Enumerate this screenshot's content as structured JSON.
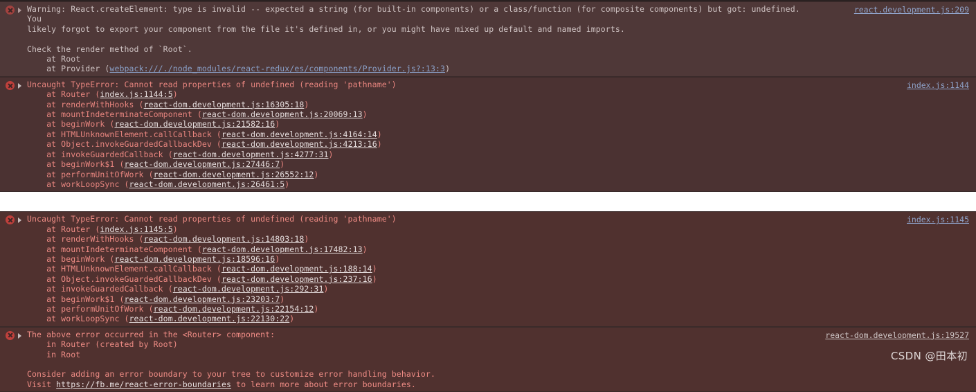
{
  "console": {
    "groups": [
      {
        "id": "group-1",
        "entries": [
          {
            "id": "entry-warning-createelement",
            "level": "warn",
            "icon": "error-circle-icon",
            "expander": "disclosure-triangle-icon",
            "origin": "react.development.js:209",
            "lines": [
              {
                "segments": [
                  {
                    "t": "Warning: React.createElement: type is invalid -- expected a string (for built-in components) or a class/function (for composite components) but got: undefined. You"
                  }
                ]
              },
              {
                "segments": [
                  {
                    "t": "likely forgot to export your component from the file it's defined in, or you might have mixed up default and named imports."
                  }
                ]
              },
              {
                "segments": [
                  {
                    "t": ""
                  }
                ]
              },
              {
                "segments": [
                  {
                    "t": "Check the render method of `Root`."
                  }
                ]
              },
              {
                "segments": [
                  {
                    "t": "    at Root"
                  }
                ]
              },
              {
                "segments": [
                  {
                    "t": "    at Provider ("
                  },
                  {
                    "t": "webpack:///./node_modules/react-redux/es/components/Provider.js?:13:3",
                    "link": true
                  },
                  {
                    "t": ")"
                  }
                ]
              }
            ]
          },
          {
            "id": "entry-uncaught-typeerror-1144",
            "level": "err",
            "icon": "error-circle-icon",
            "expander": "disclosure-triangle-icon",
            "origin": "index.js:1144",
            "lines": [
              {
                "segments": [
                  {
                    "t": "Uncaught TypeError: Cannot read properties of undefined (reading 'pathname')"
                  }
                ]
              },
              {
                "segments": [
                  {
                    "t": "    at Router ("
                  },
                  {
                    "t": "index.js:1144:5",
                    "link": true,
                    "white": true
                  },
                  {
                    "t": ")"
                  }
                ]
              },
              {
                "segments": [
                  {
                    "t": "    at renderWithHooks ("
                  },
                  {
                    "t": "react-dom.development.js:16305:18",
                    "link": true,
                    "white": true
                  },
                  {
                    "t": ")"
                  }
                ]
              },
              {
                "segments": [
                  {
                    "t": "    at mountIndeterminateComponent ("
                  },
                  {
                    "t": "react-dom.development.js:20069:13",
                    "link": true,
                    "white": true
                  },
                  {
                    "t": ")"
                  }
                ]
              },
              {
                "segments": [
                  {
                    "t": "    at beginWork ("
                  },
                  {
                    "t": "react-dom.development.js:21582:16",
                    "link": true,
                    "white": true
                  },
                  {
                    "t": ")"
                  }
                ]
              },
              {
                "segments": [
                  {
                    "t": "    at HTMLUnknownElement.callCallback ("
                  },
                  {
                    "t": "react-dom.development.js:4164:14",
                    "link": true,
                    "white": true
                  },
                  {
                    "t": ")"
                  }
                ]
              },
              {
                "segments": [
                  {
                    "t": "    at Object.invokeGuardedCallbackDev ("
                  },
                  {
                    "t": "react-dom.development.js:4213:16",
                    "link": true,
                    "white": true
                  },
                  {
                    "t": ")"
                  }
                ]
              },
              {
                "segments": [
                  {
                    "t": "    at invokeGuardedCallback ("
                  },
                  {
                    "t": "react-dom.development.js:4277:31",
                    "link": true,
                    "white": true
                  },
                  {
                    "t": ")"
                  }
                ]
              },
              {
                "segments": [
                  {
                    "t": "    at beginWork$1 ("
                  },
                  {
                    "t": "react-dom.development.js:27446:7",
                    "link": true,
                    "white": true
                  },
                  {
                    "t": ")"
                  }
                ]
              },
              {
                "segments": [
                  {
                    "t": "    at performUnitOfWork ("
                  },
                  {
                    "t": "react-dom.development.js:26552:12",
                    "link": true,
                    "white": true
                  },
                  {
                    "t": ")"
                  }
                ]
              },
              {
                "segments": [
                  {
                    "t": "    at workLoopSync ("
                  },
                  {
                    "t": "react-dom.development.js:26461:5",
                    "link": true,
                    "white": true
                  },
                  {
                    "t": ")"
                  }
                ]
              }
            ]
          }
        ]
      },
      {
        "id": "group-2",
        "entries": [
          {
            "id": "entry-uncaught-typeerror-1145",
            "level": "err-bright",
            "icon": "error-circle-icon",
            "expander": "disclosure-triangle-icon",
            "origin": "index.js:1145",
            "lines": [
              {
                "segments": [
                  {
                    "t": "Uncaught TypeError: Cannot read properties of undefined (reading 'pathname')"
                  }
                ]
              },
              {
                "segments": [
                  {
                    "t": "    at Router ("
                  },
                  {
                    "t": "index.js:1145:5",
                    "link": true,
                    "white": true
                  },
                  {
                    "t": ")"
                  }
                ]
              },
              {
                "segments": [
                  {
                    "t": "    at renderWithHooks ("
                  },
                  {
                    "t": "react-dom.development.js:14803:18",
                    "link": true,
                    "white": true
                  },
                  {
                    "t": ")"
                  }
                ]
              },
              {
                "segments": [
                  {
                    "t": "    at mountIndeterminateComponent ("
                  },
                  {
                    "t": "react-dom.development.js:17482:13",
                    "link": true,
                    "white": true
                  },
                  {
                    "t": ")"
                  }
                ]
              },
              {
                "segments": [
                  {
                    "t": "    at beginWork ("
                  },
                  {
                    "t": "react-dom.development.js:18596:16",
                    "link": true,
                    "white": true
                  },
                  {
                    "t": ")"
                  }
                ]
              },
              {
                "segments": [
                  {
                    "t": "    at HTMLUnknownElement.callCallback ("
                  },
                  {
                    "t": "react-dom.development.js:188:14",
                    "link": true,
                    "white": true
                  },
                  {
                    "t": ")"
                  }
                ]
              },
              {
                "segments": [
                  {
                    "t": "    at Object.invokeGuardedCallbackDev ("
                  },
                  {
                    "t": "react-dom.development.js:237:16",
                    "link": true,
                    "white": true
                  },
                  {
                    "t": ")"
                  }
                ]
              },
              {
                "segments": [
                  {
                    "t": "    at invokeGuardedCallback ("
                  },
                  {
                    "t": "react-dom.development.js:292:31",
                    "link": true,
                    "white": true
                  },
                  {
                    "t": ")"
                  }
                ]
              },
              {
                "segments": [
                  {
                    "t": "    at beginWork$1 ("
                  },
                  {
                    "t": "react-dom.development.js:23203:7",
                    "link": true,
                    "white": true
                  },
                  {
                    "t": ")"
                  }
                ]
              },
              {
                "segments": [
                  {
                    "t": "    at performUnitOfWork ("
                  },
                  {
                    "t": "react-dom.development.js:22154:12",
                    "link": true,
                    "white": true
                  },
                  {
                    "t": ")"
                  }
                ]
              },
              {
                "segments": [
                  {
                    "t": "    at workLoopSync ("
                  },
                  {
                    "t": "react-dom.development.js:22130:22",
                    "link": true,
                    "white": true
                  },
                  {
                    "t": ")"
                  }
                ]
              }
            ]
          },
          {
            "id": "entry-above-error-router",
            "level": "err-bright",
            "icon": "error-circle-icon",
            "expander": "disclosure-triangle-icon",
            "origin": "react-dom.development.js:19527",
            "originStyle": "greyish",
            "lines": [
              {
                "segments": [
                  {
                    "t": "The above error occurred in the <Router> component:"
                  }
                ]
              },
              {
                "segments": [
                  {
                    "t": "    in Router (created by Root)"
                  }
                ]
              },
              {
                "segments": [
                  {
                    "t": "    in Root"
                  }
                ]
              },
              {
                "segments": [
                  {
                    "t": ""
                  }
                ]
              },
              {
                "segments": [
                  {
                    "t": "Consider adding an error boundary to your tree to customize error handling behavior."
                  }
                ]
              },
              {
                "segments": [
                  {
                    "t": "Visit "
                  },
                  {
                    "t": "https://fb.me/react-error-boundaries",
                    "link": true,
                    "white": true
                  },
                  {
                    "t": " to learn more about error boundaries."
                  }
                ]
              }
            ]
          }
        ]
      }
    ],
    "watermark": "CSDN @田本初"
  }
}
